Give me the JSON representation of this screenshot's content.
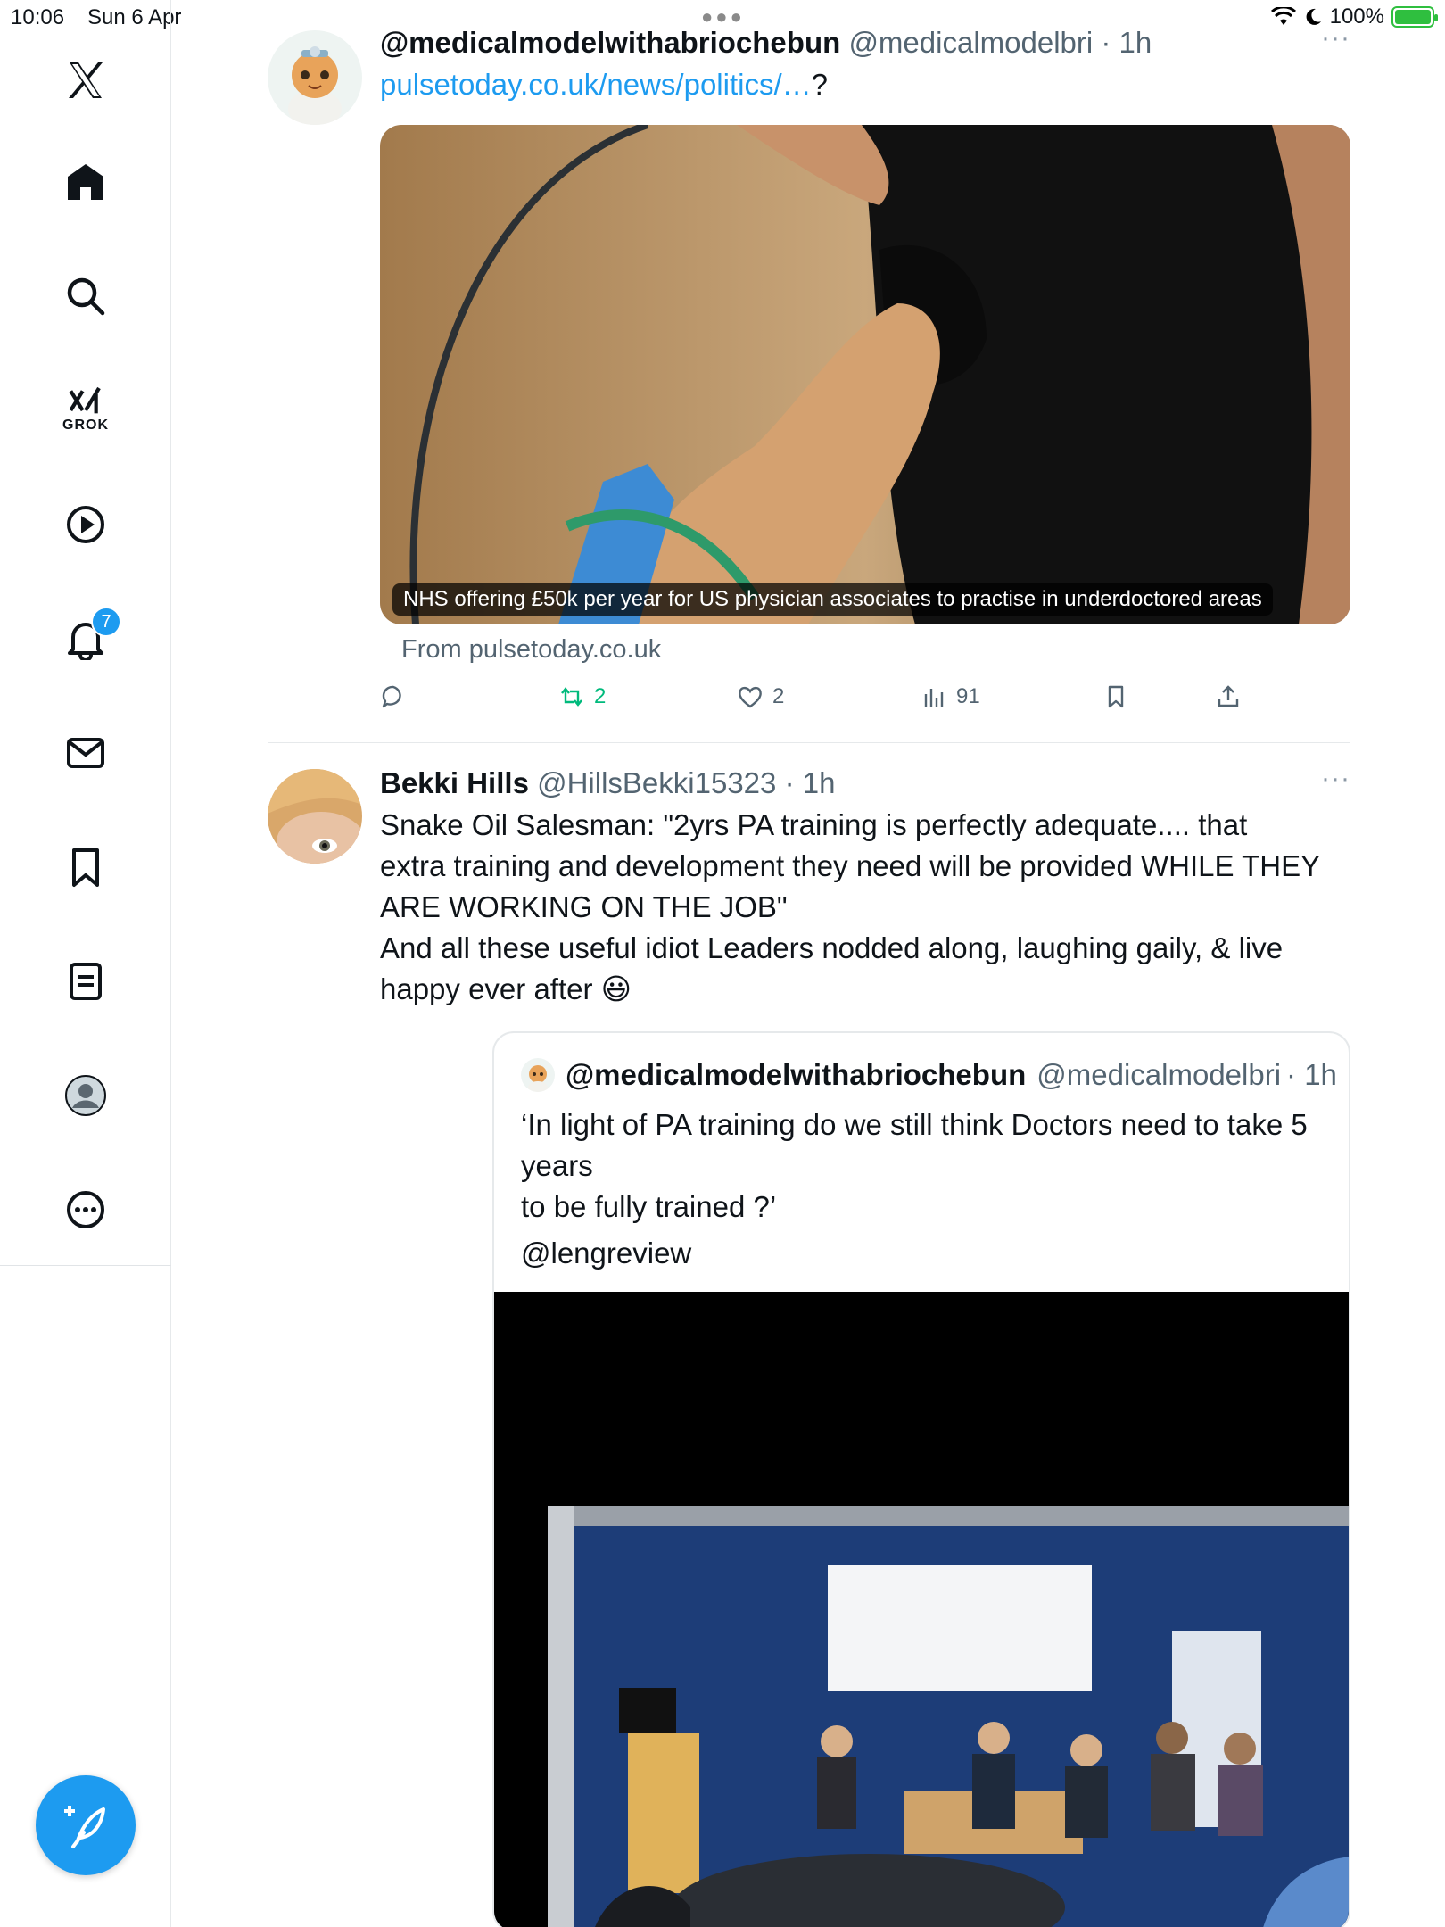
{
  "status_bar": {
    "time": "10:06",
    "date": "Sun 6 Apr",
    "battery_pct": "100%"
  },
  "sidebar": {
    "items": [
      {
        "name": "x-logo"
      },
      {
        "name": "home"
      },
      {
        "name": "search"
      },
      {
        "name": "grok",
        "label": "GROK"
      },
      {
        "name": "videos"
      },
      {
        "name": "notifications",
        "badge": "7"
      },
      {
        "name": "messages"
      },
      {
        "name": "bookmarks"
      },
      {
        "name": "lists"
      },
      {
        "name": "profile"
      },
      {
        "name": "more"
      }
    ],
    "compose_icon": "compose-feather-icon"
  },
  "tweets": [
    {
      "name": "@medicalmodelwithabriochebun",
      "handle": "@medicalmodelbri",
      "time": "· 1h",
      "link": "pulsetoday.co.uk/news/politics/…",
      "link_suffix": "?",
      "card_caption": "NHS offering £50k per year for US physician associates to practise in underdoctored areas",
      "from": "From pulsetoday.co.uk",
      "actions": {
        "reply": "",
        "retweets": "2",
        "likes": "2",
        "views": "91"
      }
    },
    {
      "name": "Bekki Hills",
      "handle": "@HillsBekki15323",
      "time": "· 1h",
      "text_lines": [
        "Snake Oil Salesman: \"2yrs PA  training is perfectly adequate.... that",
        "extra training and development they need will be provided WHILE THEY",
        "ARE WORKING ON THE JOB\"",
        "And all these useful idiot Leaders nodded along, laughing gaily, & live",
        "happy ever after 😃"
      ],
      "quote": {
        "name": "@medicalmodelwithabriochebun",
        "handle": "@medicalmodelbri",
        "time": "· 1h",
        "text_lines": [
          "‘In light of PA training do we still think Doctors need to take 5 years",
          "to be fully trained ?’"
        ],
        "mention": "@lengreview"
      }
    }
  ],
  "colors": {
    "accent": "#1d9bf0",
    "retweet_green": "#00ba7c",
    "secondary_text": "#536471"
  }
}
